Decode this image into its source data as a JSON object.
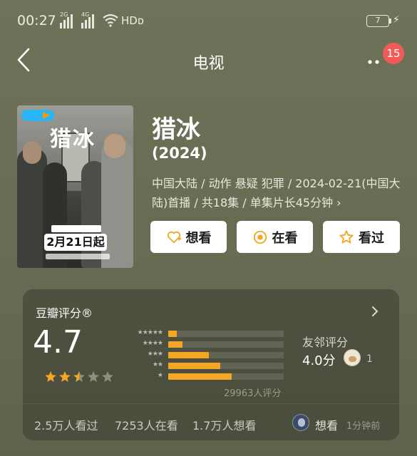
{
  "status_bar": {
    "time": "00:27",
    "signal1_label": "2G",
    "signal2_label": "4G",
    "network": "HDᴅ",
    "battery": "7"
  },
  "nav": {
    "title": "电视",
    "badge_count": "15"
  },
  "poster": {
    "title": "猎冰",
    "date_text": "2月21日起"
  },
  "movie": {
    "title": "猎冰",
    "year": "(2024)",
    "meta": "中国大陆 / 动作 悬疑 犯罪 / 2024-02-21(中国大陆)首播 / 共18集 / 单集片长45分钟 ›"
  },
  "actions": {
    "want": "想看",
    "watching": "在看",
    "watched": "看过"
  },
  "rating": {
    "title": "豆瓣评分®",
    "score": "4.7",
    "stars": 2.5,
    "distribution_percent": [
      3,
      5,
      14,
      18,
      22
    ],
    "distribution_stars": [
      "★★★★★",
      "★★★★",
      "★★★",
      "★★",
      "★"
    ],
    "vote_count": "29963人评分",
    "friend_label": "友邻评分",
    "friend_score": "4.0分",
    "friend_count": "1"
  },
  "stats": {
    "watched": "2.5万人看过",
    "watching": "7253人在看",
    "want": "1.7万人想看"
  },
  "activity": {
    "status": "想看",
    "time": "1分钟前"
  },
  "colors": {
    "background": "#6b6f55",
    "accent_star": "#f5a623",
    "badge": "#f25a5a"
  }
}
